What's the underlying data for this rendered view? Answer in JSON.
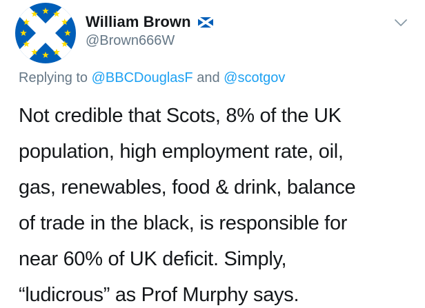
{
  "tweet": {
    "author": {
      "display_name": "William Brown",
      "handle": "@Brown666W",
      "flag_icon": "scotland-flag-icon",
      "avatar_icon": "saltire-eu-stars-avatar"
    },
    "replying": {
      "prefix": "Replying to",
      "mention_1": "@BBCDouglasF",
      "joiner": "and",
      "mention_2": "@scotgov"
    },
    "body": "Not credible that Scots, 8% of the UK\npopulation, high employment rate, oil,\ngas, renewables, food & drink, balance\nof trade in the black, is responsible for\nnear 60% of UK deficit. Simply,\n“ludicrous” as Prof Murphy says.",
    "menu_icon": "chevron-down-icon"
  },
  "colors": {
    "mention_blue": "#1da1f2",
    "secondary_gray": "#657786",
    "text_dark": "#14171a",
    "saltire_blue": "#005eb8",
    "eu_star_yellow": "#ffdd00"
  }
}
